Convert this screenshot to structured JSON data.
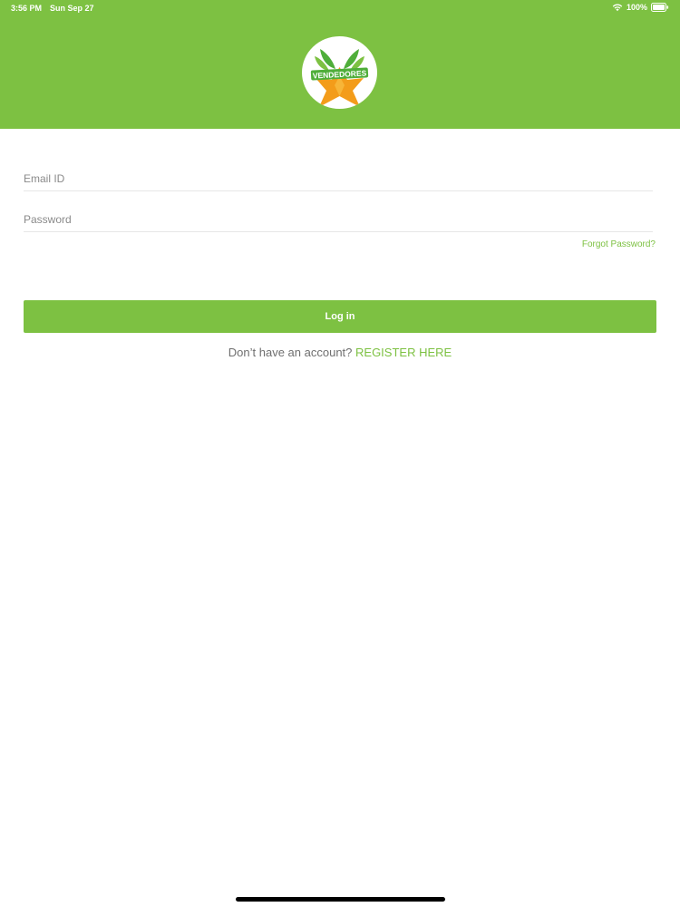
{
  "status_bar": {
    "time": "3:56 PM",
    "date": "Sun Sep 27",
    "battery": "100%",
    "wifi_icon": "wifi-icon",
    "battery_icon": "battery-icon"
  },
  "header": {
    "background_color": "#7dc142",
    "logo": {
      "text": "VENDEDORES",
      "icon": "vendedores-logo"
    }
  },
  "form": {
    "email": {
      "placeholder": "Email ID",
      "value": ""
    },
    "password": {
      "placeholder": "Password",
      "value": ""
    },
    "forgot_password_label": "Forgot Password?",
    "login_label": "Log in",
    "register_prompt": "Don’t have an account? ",
    "register_link_label": "REGISTER HERE"
  },
  "colors": {
    "accent": "#7dc142",
    "logo_orange": "#f39c1a",
    "text_gray": "#6f6f6f"
  }
}
